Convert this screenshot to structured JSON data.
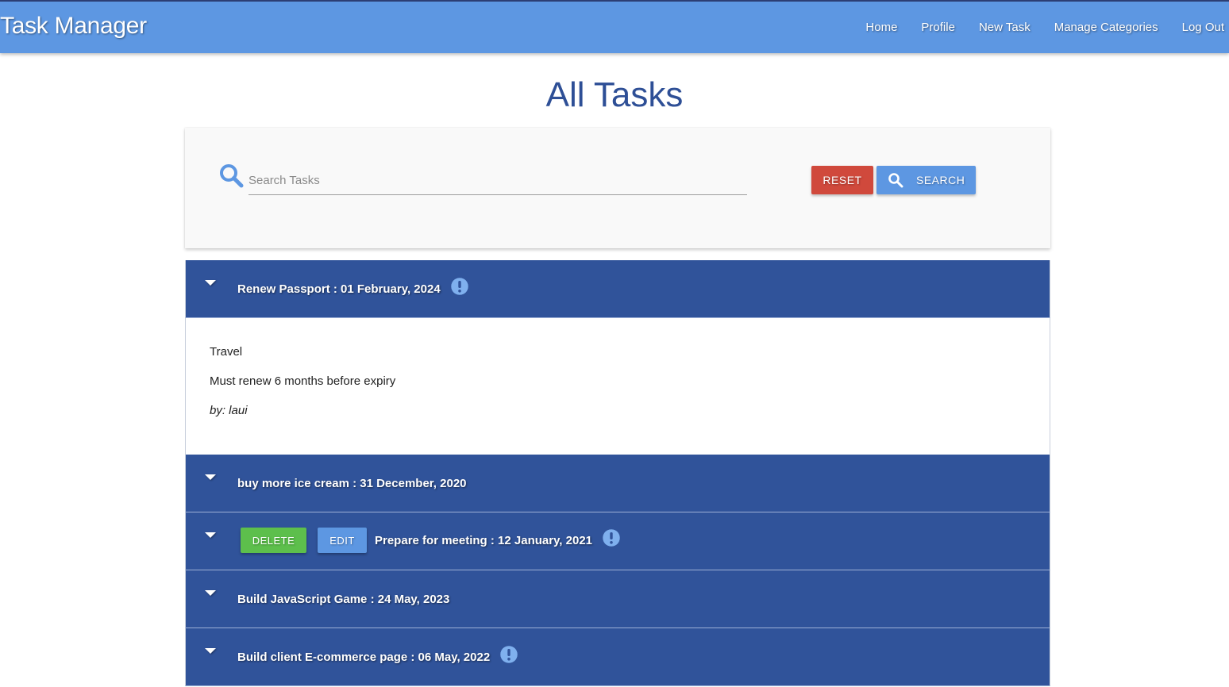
{
  "navbar": {
    "brand": "Task Manager",
    "links": [
      "Home",
      "Profile",
      "New Task",
      "Manage Categories",
      "Log Out"
    ]
  },
  "page": {
    "title": "All Tasks"
  },
  "search": {
    "placeholder": "Search Tasks",
    "value": "",
    "reset_label": "RESET",
    "search_label": "SEARCH"
  },
  "colors": {
    "navbar": "#5d97e2",
    "task_header": "#30539a",
    "reset": "#d0493c",
    "delete": "#5dbf4c",
    "edit": "#5d97e2",
    "alert_icon": "#7fb0ee"
  },
  "tasks": [
    {
      "title": "Renew Passport : 01 February, 2024",
      "urgent": true,
      "expanded": true,
      "category": "Travel",
      "description": "Must renew 6 months before expiry",
      "author": "by: laui"
    },
    {
      "title": "buy more ice cream : 31 December, 2020",
      "urgent": false
    },
    {
      "title": "Prepare for meeting : 12 January, 2021",
      "urgent": true,
      "delete_label": "DELETE",
      "edit_label": "EDIT"
    },
    {
      "title": "Build JavaScript Game : 24 May, 2023",
      "urgent": false
    },
    {
      "title": "Build client E-commerce page : 06 May, 2022",
      "urgent": true
    }
  ]
}
